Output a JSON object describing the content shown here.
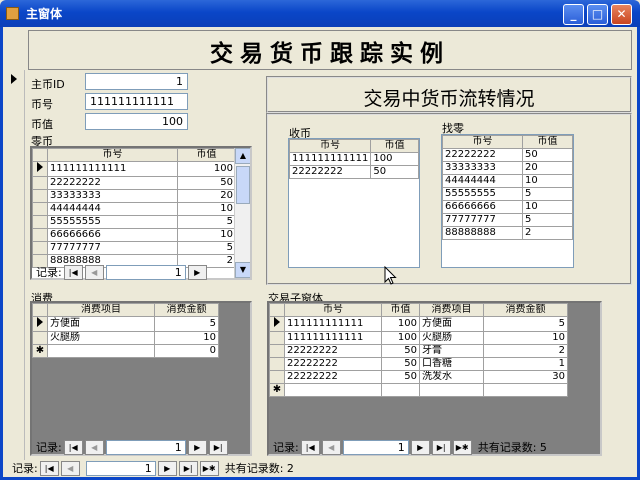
{
  "window": {
    "title": "主窗体"
  },
  "header": {
    "title": "交易货币跟踪实例"
  },
  "main_form": {
    "id_label": "主币ID",
    "id_value": "1",
    "code_label": "币号",
    "code_value": "111111111111",
    "value_label": "币值",
    "value_value": "100"
  },
  "change": {
    "label": "零币",
    "columns": [
      "币号",
      "币值"
    ],
    "rows": [
      {
        "code": "111111111111",
        "value": "100"
      },
      {
        "code": "22222222",
        "value": "50"
      },
      {
        "code": "33333333",
        "value": "20"
      },
      {
        "code": "44444444",
        "value": "10"
      },
      {
        "code": "55555555",
        "value": "5"
      },
      {
        "code": "66666666",
        "value": "10"
      },
      {
        "code": "77777777",
        "value": "5"
      },
      {
        "code": "88888888",
        "value": "2"
      }
    ],
    "nav": {
      "record_label": "记录:",
      "current": "1"
    }
  },
  "flow": {
    "title": "交易中货币流转情况",
    "received": {
      "label": "收币",
      "columns": [
        "币号",
        "币值"
      ],
      "rows": [
        {
          "code": "111111111111",
          "value": "100"
        },
        {
          "code": "22222222",
          "value": "50"
        }
      ]
    },
    "given_change": {
      "label": "找零",
      "columns": [
        "币号",
        "币值"
      ],
      "rows": [
        {
          "code": "22222222",
          "value": "50"
        },
        {
          "code": "33333333",
          "value": "20"
        },
        {
          "code": "44444444",
          "value": "10"
        },
        {
          "code": "55555555",
          "value": "5"
        },
        {
          "code": "66666666",
          "value": "10"
        },
        {
          "code": "77777777",
          "value": "5"
        },
        {
          "code": "88888888",
          "value": "2"
        }
      ]
    }
  },
  "consume": {
    "label": "消费",
    "columns": [
      "消费项目",
      "消费金额"
    ],
    "rows": [
      {
        "item": "方便面",
        "amount": "5"
      },
      {
        "item": "火腿肠",
        "amount": "10"
      }
    ],
    "new_row_amount": "0",
    "nav": {
      "record_label": "记录:",
      "current": "1"
    }
  },
  "trade_sub": {
    "label": "交易子窗体",
    "columns": [
      "币号",
      "币值",
      "消费项目",
      "消费金额"
    ],
    "rows": [
      {
        "code": "111111111111",
        "value": "100",
        "item": "方便面",
        "amount": "5"
      },
      {
        "code": "111111111111",
        "value": "100",
        "item": "火腿肠",
        "amount": "10"
      },
      {
        "code": "22222222",
        "value": "50",
        "item": "牙膏",
        "amount": "2"
      },
      {
        "code": "22222222",
        "value": "50",
        "item": "口香糖",
        "amount": "1"
      },
      {
        "code": "22222222",
        "value": "50",
        "item": "洗发水",
        "amount": "30"
      }
    ],
    "nav": {
      "record_label": "记录:",
      "current": "1",
      "total": "共有记录数: 5"
    }
  },
  "main_nav": {
    "record_label": "记录:",
    "current": "1",
    "total": "共有记录数: 2"
  },
  "colors": {
    "titlebar": "#0b46c8",
    "form_bg": "#ece9d8",
    "subform_empty": "#808080"
  }
}
